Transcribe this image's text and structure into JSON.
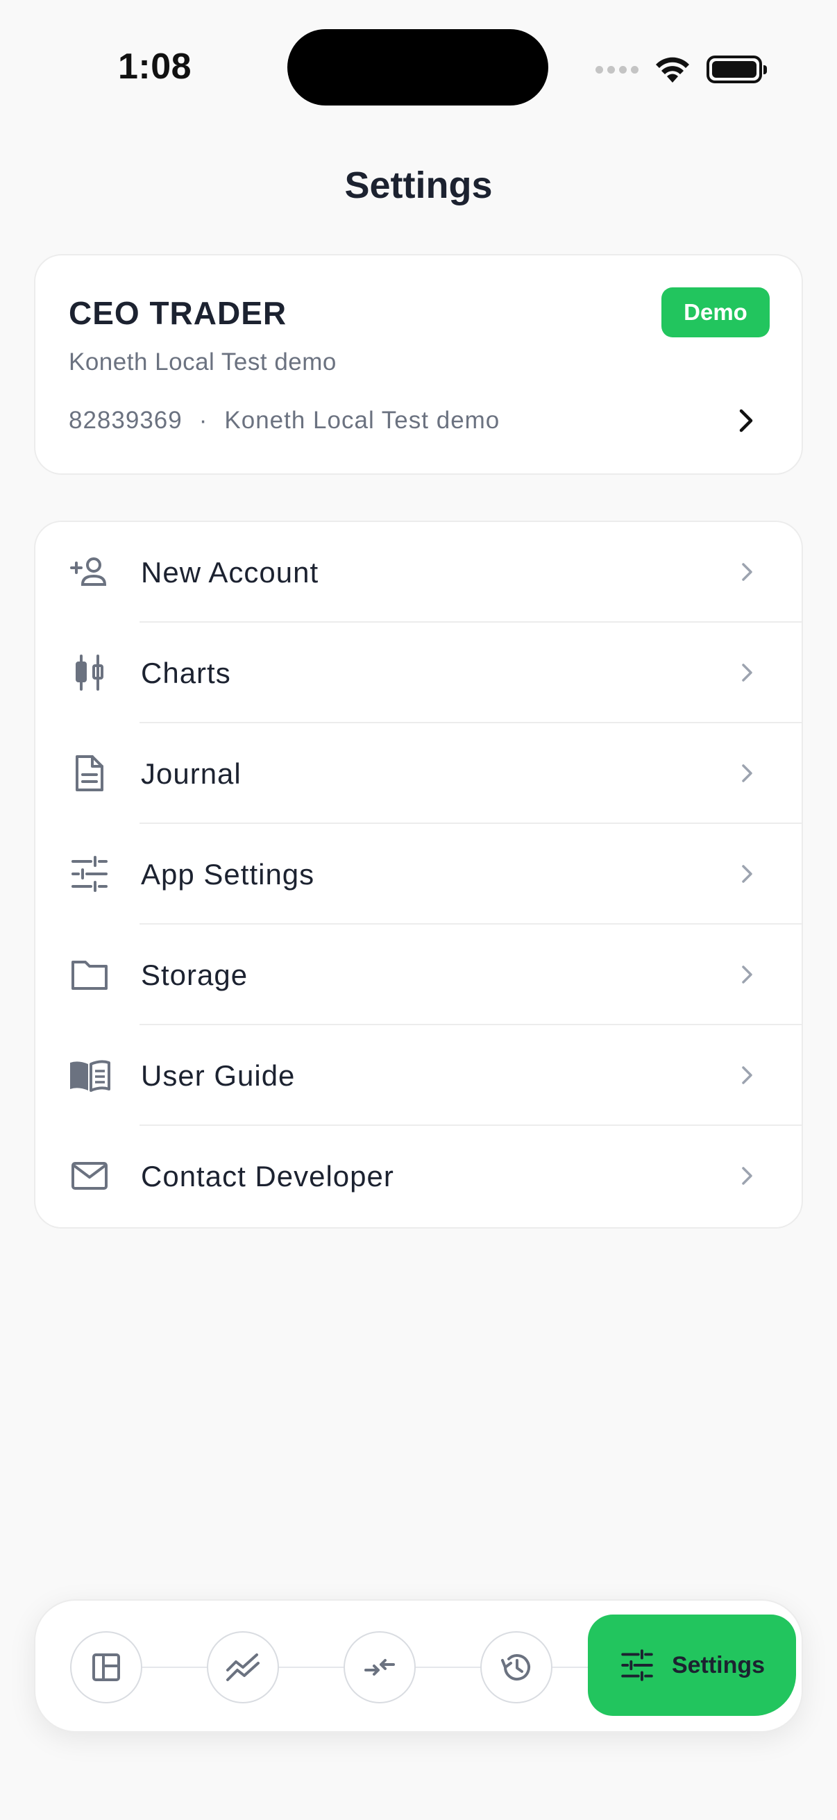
{
  "status_bar": {
    "time": "1:08"
  },
  "header": {
    "title": "Settings"
  },
  "account": {
    "name": "CEO TRADER",
    "badge": "Demo",
    "subtitle": "Koneth Local Test demo",
    "number": "82839369",
    "separator": "·",
    "server": "Koneth Local Test demo"
  },
  "menu": {
    "items": [
      {
        "label": "New Account",
        "icon": "add-person-icon"
      },
      {
        "label": "Charts",
        "icon": "candlestick-icon"
      },
      {
        "label": "Journal",
        "icon": "document-icon"
      },
      {
        "label": "App Settings",
        "icon": "sliders-icon"
      },
      {
        "label": "Storage",
        "icon": "folder-icon"
      },
      {
        "label": "User Guide",
        "icon": "book-icon"
      },
      {
        "label": "Contact Developer",
        "icon": "mail-icon"
      }
    ]
  },
  "bottom_nav": {
    "items": [
      {
        "icon": "dashboard-icon"
      },
      {
        "icon": "trend-icon"
      },
      {
        "icon": "trade-icon"
      },
      {
        "icon": "history-icon"
      }
    ],
    "active_label": "Settings",
    "active_icon": "sliders-icon"
  },
  "colors": {
    "accent": "#22c55e",
    "text": "#1c2230",
    "muted": "#6b7280",
    "background": "#f9f9f9"
  }
}
